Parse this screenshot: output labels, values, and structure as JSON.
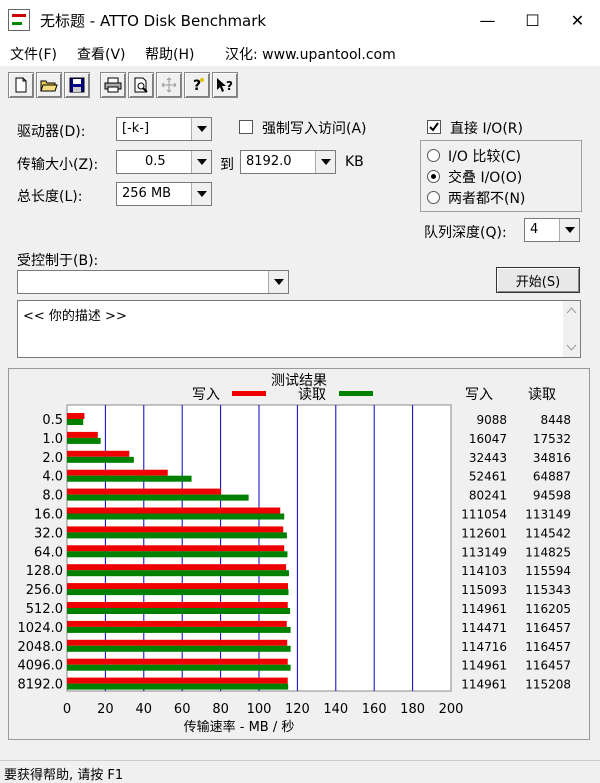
{
  "window": {
    "title": "无标题 - ATTO Disk Benchmark",
    "minimize": "—",
    "maximize": "☐",
    "close": "✕"
  },
  "menu": {
    "items": [
      "文件(F)",
      "查看(V)",
      "帮助(H)",
      "汉化: www.upantool.com"
    ]
  },
  "toolbar": {
    "icons": [
      "new-icon",
      "open-icon",
      "save-icon",
      "print-icon",
      "print-preview-icon",
      "move-icon",
      "help-icon",
      "context-help-icon"
    ]
  },
  "form": {
    "drive_label": "驱动器(D):",
    "drive_value": "[-k-]",
    "force_write_label": "强制写入访问(A)",
    "direct_io_label": "直接 I/O(R)",
    "transfer_label": "传输大小(Z):",
    "transfer_from": "0.5",
    "to_label": "到",
    "transfer_to": "8192.0",
    "kb_label": "KB",
    "total_label": "总长度(L):",
    "total_value": "256 MB",
    "io_compare_label": "I/O 比较(C)",
    "overlap_label": "交叠 I/O(O)",
    "neither_label": "两者都不(N)",
    "queue_label": "队列深度(Q):",
    "queue_value": "4",
    "controlled_label": "受控制于(B):",
    "controlled_value": "",
    "start_button": "开始(S)",
    "description": "<< 你的描述 >>"
  },
  "colors": {
    "write": "#ee0000",
    "read": "#008000",
    "grid": "#0000cc"
  },
  "chart_data": {
    "type": "bar",
    "title": "测试结果",
    "legend": [
      {
        "name": "写入",
        "color": "#ee0000"
      },
      {
        "name": "读取",
        "color": "#008000"
      }
    ],
    "col_headers": [
      "写入",
      "读取"
    ],
    "xlabel": "传输速率 - MB / 秒",
    "xlim": [
      0,
      200
    ],
    "xticks": [
      "0",
      "20",
      "40",
      "60",
      "80",
      "100",
      "120",
      "140",
      "160",
      "180",
      "200"
    ],
    "categories": [
      "0.5",
      "1.0",
      "2.0",
      "4.0",
      "8.0",
      "16.0",
      "32.0",
      "64.0",
      "128.0",
      "256.0",
      "512.0",
      "1024.0",
      "2048.0",
      "4096.0",
      "8192.0"
    ],
    "series": [
      {
        "name": "写入",
        "values": [
          9088,
          16047,
          32443,
          52461,
          80241,
          111054,
          112601,
          113149,
          114103,
          115093,
          114961,
          114471,
          114716,
          114961,
          114961
        ]
      },
      {
        "name": "读取",
        "values": [
          8448,
          17532,
          34816,
          64887,
          94598,
          113149,
          114542,
          114825,
          115594,
          115343,
          116205,
          116457,
          116457,
          116457,
          115208
        ]
      }
    ]
  },
  "status": {
    "text": "要获得帮助, 请按 F1"
  }
}
